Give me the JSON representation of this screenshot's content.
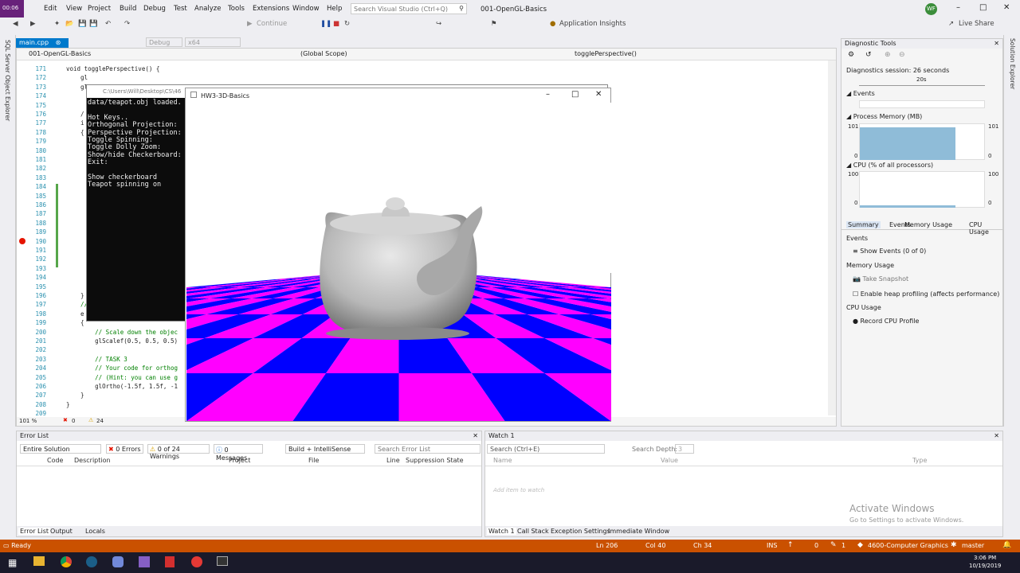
{
  "titlebar": {
    "app_badge": "00:06",
    "user_initials": "WF",
    "search_placeholder": "Search Visual Studio (Ctrl+Q)",
    "solution_name": "001-OpenGL-Basics"
  },
  "menu": [
    "Edit",
    "View",
    "Project",
    "Build",
    "Debug",
    "Test",
    "Analyze",
    "Tools",
    "Extensions",
    "Window",
    "Help"
  ],
  "toolbar": {
    "config": "Debug",
    "platform": "x64",
    "continue_label": "Continue",
    "app_insights": "Application Insights",
    "live_share": "Live Share"
  },
  "left_sidebar": {
    "label": "SQL Server Object Explorer"
  },
  "right_sidebar": {
    "label": "Solution Explorer"
  },
  "editor": {
    "tab_label": "main.cpp",
    "nav_project": "001-OpenGL-Basics",
    "nav_scope": "(Global Scope)",
    "nav_function": "togglePerspective()",
    "zoom": "101 %",
    "errors": "0",
    "warnings": "24",
    "lines": [
      {
        "n": "171",
        "t": "void togglePerspective() {"
      },
      {
        "n": "172",
        "t": "    gl"
      },
      {
        "n": "173",
        "t": "    gl"
      },
      {
        "n": "174",
        "t": ""
      },
      {
        "n": "175",
        "t": ""
      },
      {
        "n": "176",
        "t": "    /"
      },
      {
        "n": "177",
        "t": "    i"
      },
      {
        "n": "178",
        "t": "    {"
      },
      {
        "n": "179",
        "t": ""
      },
      {
        "n": "180",
        "t": ""
      },
      {
        "n": "181",
        "t": ""
      },
      {
        "n": "182",
        "t": ""
      },
      {
        "n": "183",
        "t": ""
      },
      {
        "n": "184",
        "t": ""
      },
      {
        "n": "185",
        "t": ""
      },
      {
        "n": "186",
        "t": ""
      },
      {
        "n": "187",
        "t": ""
      },
      {
        "n": "188",
        "t": ""
      },
      {
        "n": "189",
        "t": ""
      },
      {
        "n": "190",
        "t": ""
      },
      {
        "n": "191",
        "t": ""
      },
      {
        "n": "192",
        "t": ""
      },
      {
        "n": "193",
        "t": ""
      },
      {
        "n": "194",
        "t": ""
      },
      {
        "n": "195",
        "t": ""
      },
      {
        "n": "196",
        "t": "    }"
      },
      {
        "n": "197",
        "t": "    //"
      },
      {
        "n": "198",
        "t": "    e"
      },
      {
        "n": "199",
        "t": "    {"
      },
      {
        "n": "200",
        "t": "        // Scale down the objec"
      },
      {
        "n": "201",
        "t": "        glScalef(0.5, 0.5, 0.5)"
      },
      {
        "n": "202",
        "t": ""
      },
      {
        "n": "203",
        "t": "        // TASK 3"
      },
      {
        "n": "204",
        "t": "        // Your code for orthog"
      },
      {
        "n": "205",
        "t": "        // (Hint: you can use g"
      },
      {
        "n": "206",
        "t": "        glOrtho(-1.5f, 1.5f, -1"
      },
      {
        "n": "207",
        "t": "    }"
      },
      {
        "n": "208",
        "t": "}"
      },
      {
        "n": "209",
        "t": ""
      }
    ]
  },
  "console": {
    "title": "C:\\Users\\Will\\Desktop\\CS\\46",
    "lines": [
      "data/teapot.obj loaded.",
      "",
      "Hot Keys..",
      "Orthogonal Projection:",
      "Perspective Projection:",
      "Toggle Spinning:",
      "Toggle Dolly Zoom:",
      "Show/hide Checkerboard:",
      "Exit:",
      "",
      "Show checkerboard",
      "Teapot spinning on"
    ]
  },
  "gl_window": {
    "title": "HW3-3D-Basics"
  },
  "diagnostics": {
    "title": "Diagnostic Tools",
    "session": "Diagnostics session: 26 seconds",
    "timeline_label": "20s",
    "events_label": "Events",
    "memory_label": "Process Memory (MB)",
    "memory_max": "101",
    "memory_min": "0",
    "cpu_label": "CPU (% of all processors)",
    "cpu_max": "100",
    "cpu_min": "0",
    "tabs": [
      "Summary",
      "Events",
      "Memory Usage",
      "CPU Usage"
    ],
    "events_section": "Events",
    "show_events": "Show Events (0 of 0)",
    "memory_section": "Memory Usage",
    "take_snapshot": "Take Snapshot",
    "heap_profiling": "Enable heap profiling (affects performance)",
    "cpu_section": "CPU Usage",
    "record_cpu": "Record CPU Profile"
  },
  "error_list": {
    "title": "Error List",
    "scope": "Entire Solution",
    "errors_btn": "0 Errors",
    "warnings_btn": "0 of 24 Warnings",
    "messages_btn": "0 Messages",
    "build_filter": "Build + IntelliSense",
    "search_placeholder": "Search Error List",
    "columns": [
      "Code",
      "Description",
      "Project",
      "File",
      "Line",
      "Suppression State"
    ],
    "tabs": [
      "Error List",
      "Output",
      "Locals"
    ]
  },
  "watch": {
    "title": "Watch 1",
    "search_placeholder": "Search (Ctrl+E)",
    "search_depth_label": "Search Depth:",
    "search_depth": "3",
    "columns": [
      "Name",
      "Value",
      "Type"
    ],
    "add_item": "Add item to watch",
    "tabs": [
      "Watch 1",
      "Call Stack",
      "Exception Settings",
      "Immediate Window"
    ]
  },
  "watermark": {
    "line1": "Activate Windows",
    "line2": "Go to Settings to activate Windows."
  },
  "status": {
    "ready": "Ready",
    "ln": "Ln 206",
    "col": "Col 40",
    "ch": "Ch 34",
    "ins": "INS",
    "up": "0",
    "pencil": "1",
    "repo": "4600-Computer Graphics",
    "branch": "master"
  },
  "taskbar": {
    "time": "3:06 PM",
    "date": "10/19/2019"
  }
}
